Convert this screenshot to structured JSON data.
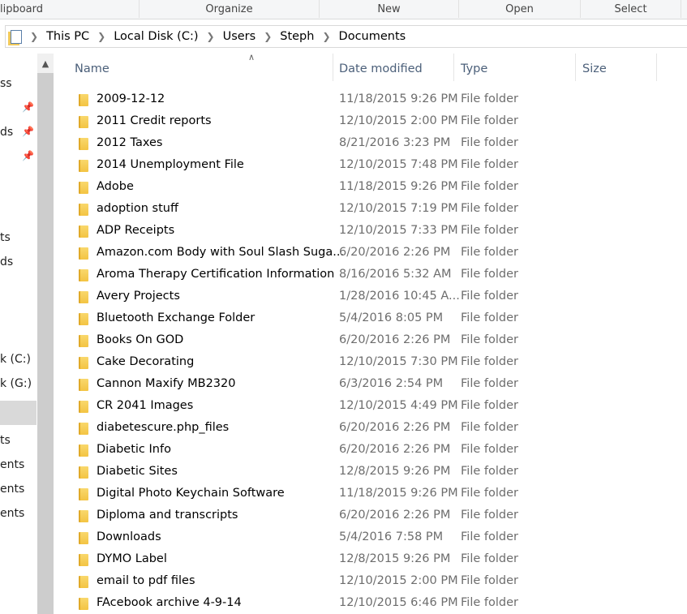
{
  "ribbon": {
    "groups": [
      "lipboard",
      "Organize",
      "New",
      "Open",
      "Select"
    ]
  },
  "address": {
    "crumbs": [
      "This PC",
      "Local Disk (C:)",
      "Users",
      "Steph",
      "Documents"
    ]
  },
  "sidebar": {
    "items": [
      {
        "label": "ss",
        "pinned": false
      },
      {
        "label": "",
        "pinned": true
      },
      {
        "label": "ds",
        "pinned": true
      },
      {
        "label": "",
        "pinned": true
      },
      {
        "label": "ts"
      },
      {
        "label": "ds"
      },
      {
        "label": "k (C:)",
        "selected": true
      },
      {
        "label": "k (G:)"
      },
      {
        "label": "ts"
      },
      {
        "label": "ents"
      },
      {
        "label": "ents"
      },
      {
        "label": "ents"
      }
    ]
  },
  "columns": {
    "name": "Name",
    "date": "Date modified",
    "type": "Type",
    "size": "Size"
  },
  "files": [
    [
      "2009-12-12",
      "11/18/2015 9:26 PM",
      "File folder"
    ],
    [
      "2011 Credit reports",
      "12/10/2015 2:00 PM",
      "File folder"
    ],
    [
      "2012 Taxes",
      "8/21/2016 3:23 PM",
      "File folder"
    ],
    [
      "2014 Unemployment File",
      "12/10/2015 7:48 PM",
      "File folder"
    ],
    [
      "Adobe",
      "11/18/2015 9:26 PM",
      "File folder"
    ],
    [
      "adoption stuff",
      "12/10/2015 7:19 PM",
      "File folder"
    ],
    [
      "ADP Receipts",
      "12/10/2015 7:33 PM",
      "File folder"
    ],
    [
      "Amazon.com  Body with Soul  Slash Suga...",
      "6/20/2016 2:26 PM",
      "File folder"
    ],
    [
      "Aroma Therapy Certification Information",
      "8/16/2016 5:32 AM",
      "File folder"
    ],
    [
      "Avery Projects",
      "1/28/2016 10:45 A...",
      "File folder"
    ],
    [
      "Bluetooth Exchange Folder",
      "5/4/2016 8:05 PM",
      "File folder"
    ],
    [
      "Books On GOD",
      "6/20/2016 2:26 PM",
      "File folder"
    ],
    [
      "Cake Decorating",
      "12/10/2015 7:30 PM",
      "File folder"
    ],
    [
      "Cannon Maxify MB2320",
      "6/3/2016 2:54 PM",
      "File folder"
    ],
    [
      "CR 2041 Images",
      "12/10/2015 4:49 PM",
      "File folder"
    ],
    [
      "diabetescure.php_files",
      "6/20/2016 2:26 PM",
      "File folder"
    ],
    [
      "Diabetic Info",
      "6/20/2016 2:26 PM",
      "File folder"
    ],
    [
      "Diabetic Sites",
      "12/8/2015 9:26 PM",
      "File folder"
    ],
    [
      "Digital Photo Keychain Software",
      "11/18/2015 9:26 PM",
      "File folder"
    ],
    [
      "Diploma and transcripts",
      "6/20/2016 2:26 PM",
      "File folder"
    ],
    [
      "Downloads",
      "5/4/2016 7:58 PM",
      "File folder"
    ],
    [
      "DYMO Label",
      "12/8/2015 9:26 PM",
      "File folder"
    ],
    [
      "email to pdf files",
      "12/10/2015 2:00 PM",
      "File folder"
    ],
    [
      "FAcebook archive 4-9-14",
      "12/10/2015 6:46 PM",
      "File folder"
    ]
  ]
}
